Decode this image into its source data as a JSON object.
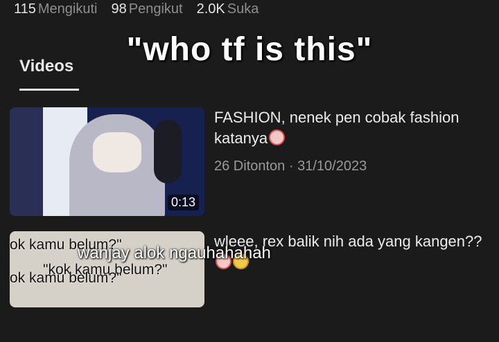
{
  "stats": [
    {
      "value": "115",
      "label": "Mengikuti"
    },
    {
      "value": "98",
      "label": "Pengikut"
    },
    {
      "value": "2.0K",
      "label": "Suka"
    }
  ],
  "overlay": {
    "top_caption": "\"who tf is this\"",
    "bottom_caption": "wanjay alok ngauhahahah"
  },
  "tabs": {
    "videos_label": "Videos"
  },
  "videos": [
    {
      "title": "FASHION, nenek pen cobak fashion katanya",
      "title_emoji": "clown-face-icon",
      "views": "26 Ditonton",
      "date": "31/10/2023",
      "meta_separator": "·",
      "duration": "0:13"
    },
    {
      "title": "wleee, rex balik nih ada yang kangen??",
      "title_emojis": [
        "clown-face-icon",
        "sad-face-icon"
      ],
      "thumbnail_text": [
        "ok kamu belum?\"",
        "\"kok kamu belum?\"",
        "ok kamu belum?\""
      ]
    }
  ],
  "colors": {
    "background": "#1b1b1b",
    "text": "#e9e9e9",
    "muted": "#9a9a9a"
  }
}
